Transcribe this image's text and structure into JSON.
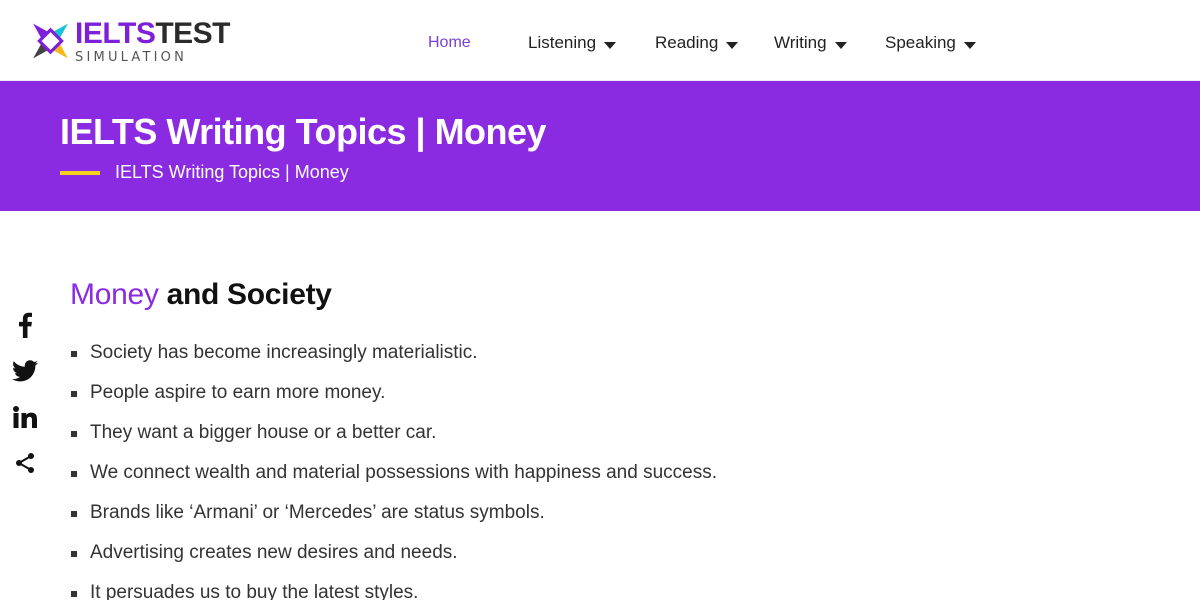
{
  "logo": {
    "word1": "IELTS",
    "word2": "TEST",
    "tagline": "SIMULATION"
  },
  "nav": {
    "home": "Home",
    "listening": "Listening",
    "reading": "Reading",
    "writing": "Writing",
    "speaking": "Speaking"
  },
  "banner": {
    "title": "IELTS Writing Topics | Money",
    "breadcrumb": "IELTS Writing Topics | Money"
  },
  "social": [
    "facebook-icon",
    "twitter-icon",
    "linkedin-icon",
    "share-icon"
  ],
  "section": {
    "title_accent": "Money",
    "title_rest": " and Society",
    "bullets": [
      "Society has become increasingly materialistic.",
      "People aspire to earn more money.",
      "They want a bigger house or a better car.",
      "We connect wealth and material possessions with happiness and success.",
      "Brands like ‘Armani’ or ‘Mercedes’ are status symbols.",
      "Advertising creates new desires and needs.",
      "It persuades us to buy the latest styles."
    ]
  },
  "colors": {
    "brand_purple": "#8a2be2",
    "accent_yellow": "#f6d21b"
  }
}
